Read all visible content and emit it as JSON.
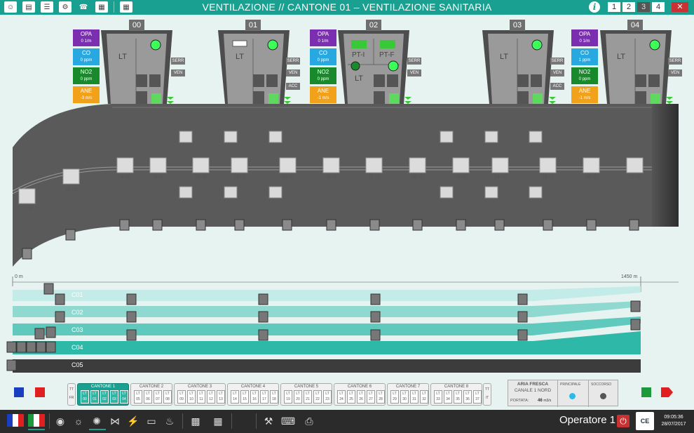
{
  "window": {
    "title": "VENTILAZIONE // CANTONE 01 – VENTILAZIONE SANITARIA",
    "pages": [
      "1",
      "2",
      "3",
      "4"
    ],
    "close_label": "✕",
    "info_label": "i"
  },
  "toolbar_icons": [
    "operator-icon",
    "document-icon",
    "book-icon",
    "road-icon",
    "phone-icon",
    "calendar-icon",
    "calculator-icon"
  ],
  "caverns": [
    {
      "label": "00",
      "lt": "LT"
    },
    {
      "label": "01",
      "lt": "LT"
    },
    {
      "label": "02",
      "lt": "LT",
      "pti": "PT-I",
      "ptf": "PT-F"
    },
    {
      "label": "03",
      "lt": "LT"
    },
    {
      "label": "04",
      "lt": "LT"
    }
  ],
  "sensors_a": {
    "opa": {
      "name": "OPA",
      "value": "0  1/m"
    },
    "co": {
      "name": "CO",
      "value": "0  ppm"
    },
    "no2": {
      "name": "NO2",
      "value": "0  ppm"
    },
    "ane": {
      "name": "ANE",
      "value": "-3  m/s"
    }
  },
  "sensors_b": {
    "opa": {
      "name": "OPA",
      "value": "0  1/m"
    },
    "co": {
      "name": "CO",
      "value": "0  ppm"
    },
    "no2": {
      "name": "NO2",
      "value": "0  ppm"
    },
    "ane": {
      "name": "ANE",
      "value": "-1  m/s"
    }
  },
  "sensors_c": {
    "opa": {
      "name": "OPA",
      "value": "0  1/m"
    },
    "co": {
      "name": "CO",
      "value": "1  ppm"
    },
    "no2": {
      "name": "NO2",
      "value": "0  ppm"
    },
    "ane": {
      "name": "ANE",
      "value": "-1  m/s"
    }
  },
  "tags": {
    "serr": "SERR",
    "ven": "VEN",
    "acc": "ACC"
  },
  "temperatures": [
    "7 °C",
    "25 °C",
    "8 °C",
    "8 °C",
    "13 °C",
    "13 °C",
    "20 °C",
    "8 °C",
    "21 °C",
    "10 °C",
    "16 °C",
    "14 °C",
    "16 °C",
    "16 °C",
    "20 °C"
  ],
  "scale": {
    "start": "0 m",
    "end": "1450 m"
  },
  "lanes": [
    "C01",
    "C02",
    "C03",
    "C04",
    "C05"
  ],
  "cantoni": [
    {
      "name": "CANTONE 1",
      "lts": [
        "00",
        "01",
        "02",
        "03",
        "04"
      ]
    },
    {
      "name": "CANTONE 2",
      "lts": [
        "05",
        "06",
        "07",
        "08"
      ]
    },
    {
      "name": "CANTONE 3",
      "lts": [
        "09",
        "10",
        "11",
        "12",
        "13"
      ]
    },
    {
      "name": "CANTONE 4",
      "lts": [
        "14",
        "15",
        "16",
        "17",
        "18"
      ]
    },
    {
      "name": "CANTONE 5",
      "lts": [
        "19",
        "20",
        "21",
        "22",
        "23"
      ]
    },
    {
      "name": "CANTONE 6",
      "lts": [
        "24",
        "25",
        "26",
        "27",
        "28"
      ]
    },
    {
      "name": "CANTONE 7",
      "lts": [
        "29",
        "30",
        "31",
        "32"
      ]
    },
    {
      "name": "CANTONE 8",
      "lts": [
        "33",
        "34",
        "35",
        "36",
        "37"
      ]
    }
  ],
  "lt_prefix": "LT",
  "side_left": {
    "top": "TT",
    "bottom": "FR"
  },
  "side_right": {
    "top": "TT",
    "bottom": "IT"
  },
  "air_box": {
    "title": "ARIA FRESCA",
    "channel": "CANALE 1 NORD",
    "portata_label": "PORTATA:",
    "portata_value": "46",
    "portata_unit": "m3/s",
    "principale": "PRINCIPALE",
    "soccorso": "SOCCORSO",
    "principale_color": "#2bb9e8",
    "soccorso_color": "#555555"
  },
  "languages": [
    "french-flag-icon",
    "italian-flag-icon"
  ],
  "taskbar_icons": [
    "traffic-light-icon",
    "lighting-icon",
    "fan-icon",
    "valve-icon",
    "power-icon",
    "monitor-icon",
    "fire-icon",
    "monitor-settings-icon",
    "map-icon",
    "tools-icon",
    "keyboard-icon",
    "printer-icon"
  ],
  "operator": "Operatore 1",
  "clock": {
    "time": "09:05:36",
    "date": "28/07/2017"
  },
  "colors": {
    "accent": "#1aa090",
    "tunnel": "#555555",
    "cavern": "#9a9a9a"
  }
}
